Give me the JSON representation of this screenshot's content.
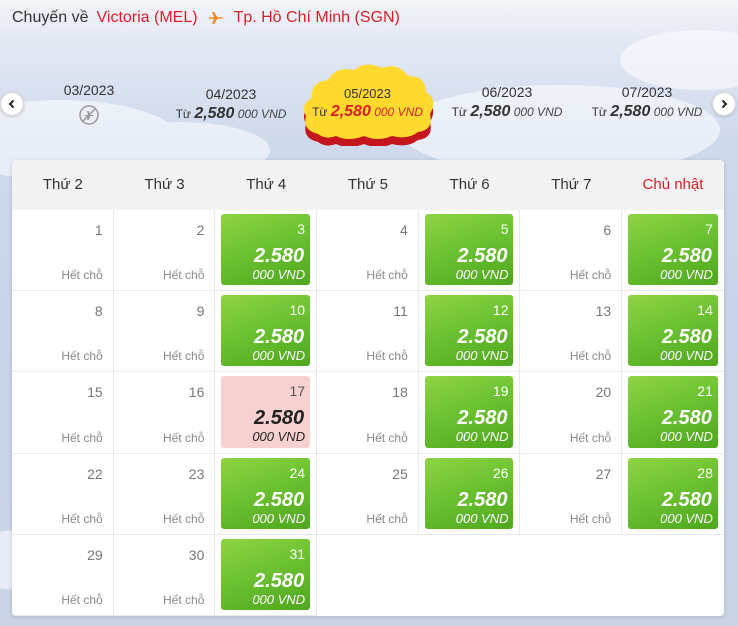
{
  "header": {
    "label": "Chuyến về",
    "origin": "Victoria (MEL)",
    "destination": "Tp. Hồ Chí Minh (SGN)"
  },
  "months": [
    {
      "name": "03/2023",
      "available": false,
      "icon": "no-flight-icon"
    },
    {
      "name": "04/2023",
      "from_label": "Từ",
      "price_main": "2,580",
      "price_suffix": "000 VND"
    },
    {
      "name": "05/2023",
      "from_label": "Từ",
      "price_main": "2,580",
      "price_suffix": "000 VND",
      "selected": true
    },
    {
      "name": "06/2023",
      "from_label": "Từ",
      "price_main": "2,580",
      "price_suffix": "000 VND"
    },
    {
      "name": "07/2023",
      "from_label": "Từ",
      "price_main": "2,580",
      "price_suffix": "000 VND"
    }
  ],
  "weekdays": [
    "Thứ 2",
    "Thứ 3",
    "Thứ 4",
    "Thứ 5",
    "Thứ 6",
    "Thứ 7",
    "Chủ nhật"
  ],
  "sold_out_label": "Hết chỗ",
  "fare": {
    "main": "2.580",
    "suffix": "000 VND"
  },
  "days": [
    {
      "day": "1",
      "avail": false
    },
    {
      "day": "2",
      "avail": false
    },
    {
      "day": "3",
      "avail": true
    },
    {
      "day": "4",
      "avail": false
    },
    {
      "day": "5",
      "avail": true
    },
    {
      "day": "6",
      "avail": false
    },
    {
      "day": "7",
      "avail": true
    },
    {
      "day": "8",
      "avail": false
    },
    {
      "day": "9",
      "avail": false
    },
    {
      "day": "10",
      "avail": true
    },
    {
      "day": "11",
      "avail": false
    },
    {
      "day": "12",
      "avail": true
    },
    {
      "day": "13",
      "avail": false
    },
    {
      "day": "14",
      "avail": true
    },
    {
      "day": "15",
      "avail": false
    },
    {
      "day": "16",
      "avail": false
    },
    {
      "day": "17",
      "avail": true,
      "selected": true
    },
    {
      "day": "18",
      "avail": false
    },
    {
      "day": "19",
      "avail": true
    },
    {
      "day": "20",
      "avail": false
    },
    {
      "day": "21",
      "avail": true
    },
    {
      "day": "22",
      "avail": false
    },
    {
      "day": "23",
      "avail": false
    },
    {
      "day": "24",
      "avail": true
    },
    {
      "day": "25",
      "avail": false
    },
    {
      "day": "26",
      "avail": true
    },
    {
      "day": "27",
      "avail": false
    },
    {
      "day": "28",
      "avail": true
    },
    {
      "day": "29",
      "avail": false
    },
    {
      "day": "30",
      "avail": false
    },
    {
      "day": "31",
      "avail": true
    }
  ],
  "colors": {
    "brand_red": "#d9202a",
    "fare_green": "#6cc231",
    "selected_pink": "#f7d1d0",
    "active_month_yellow": "#ffd92e"
  }
}
